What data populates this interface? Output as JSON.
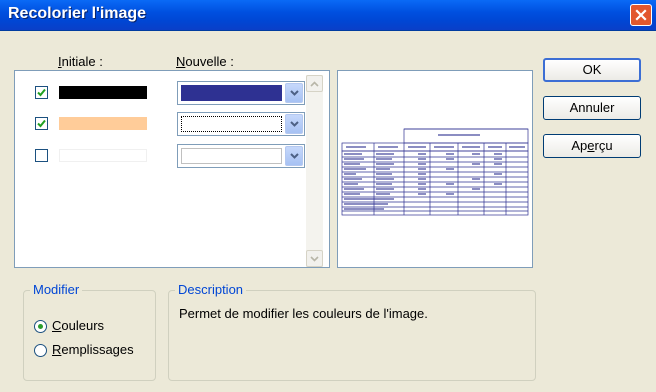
{
  "window": {
    "title": "Recolorier l'image"
  },
  "columns": {
    "initiale_pre": "",
    "initiale_key": "I",
    "initiale_post": "nitiale :",
    "nouvelle_pre": "",
    "nouvelle_key": "N",
    "nouvelle_post": "ouvelle :"
  },
  "colors": [
    {
      "checked": true,
      "original": "#000000",
      "new": "#2E3192",
      "focused": false
    },
    {
      "checked": true,
      "original": "#FFCC99",
      "new": "#FFFFFF",
      "focused": true
    },
    {
      "checked": false,
      "original": "#FFFFFF",
      "new": "#FFFFFF",
      "focused": false
    }
  ],
  "buttons": {
    "ok": "OK",
    "annuler": "Annuler",
    "apercu_pre": "Ap",
    "apercu_key": "e",
    "apercu_post": "rçu"
  },
  "modifier": {
    "title": "Modifier",
    "couleurs_key": "C",
    "couleurs_post": "ouleurs",
    "remplissages_key": "R",
    "remplissages_post": "emplissages",
    "selected": "couleurs"
  },
  "description": {
    "title": "Description",
    "text": "Permet de modifier les couleurs de l'image."
  },
  "theme": {
    "accent": "#0046D5",
    "preview_line": "#2E3192"
  }
}
